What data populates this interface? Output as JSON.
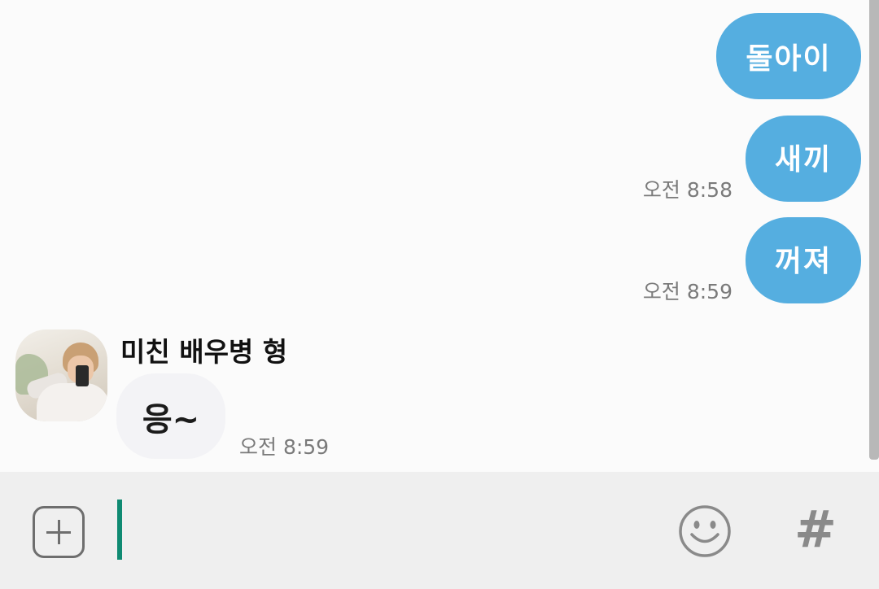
{
  "messages_out": [
    {
      "text": "돌아이",
      "time": ""
    },
    {
      "text": "새끼",
      "time": "오전 8:58"
    },
    {
      "text": "꺼져",
      "time": "오전 8:59"
    }
  ],
  "message_in": {
    "sender": "미친 배우병 형",
    "text": "응~",
    "time": "오전 8:59"
  },
  "input": {
    "value": "",
    "placeholder": ""
  },
  "icons": {
    "add": "plus-square-icon",
    "emoji": "smiley-icon",
    "hashtag": "#"
  },
  "colors": {
    "outgoing_bubble": "#55aee0",
    "incoming_bubble": "#f3f3f6",
    "caret": "#0f8a72",
    "input_bar": "#efefef"
  }
}
